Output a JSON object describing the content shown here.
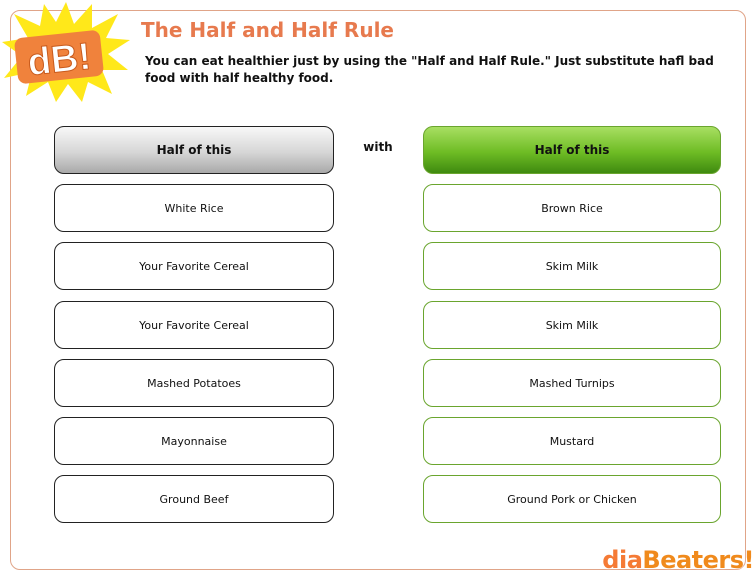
{
  "logo": {
    "text": "dB!"
  },
  "header": {
    "title": "The Half and Half Rule",
    "subtitle": "You can eat healthier just by using the \"Half and Half Rule.\" Just substitute hafl bad food with half healthy food."
  },
  "columns": {
    "left_header": "Half of this",
    "connector": "with",
    "right_header": "Half of this"
  },
  "pairs": [
    {
      "bad": "White Rice",
      "healthy": "Brown Rice"
    },
    {
      "bad": "Your Favorite Cereal",
      "healthy": "Skim Milk"
    },
    {
      "bad": "Your Favorite Cereal",
      "healthy": "Skim Milk"
    },
    {
      "bad": "Mashed Potatoes",
      "healthy": "Mashed Turnips"
    },
    {
      "bad": "Mayonnaise",
      "healthy": "Mustard"
    },
    {
      "bad": "Ground Beef",
      "healthy": "Ground Pork or Chicken"
    }
  ],
  "brand": {
    "part1": "dia",
    "part2": "Beaters!"
  },
  "colors": {
    "title": "#e77a4e",
    "frame_border": "#e0a488",
    "healthy_accent": "#6aa52e",
    "burst": "#ffe81a"
  }
}
